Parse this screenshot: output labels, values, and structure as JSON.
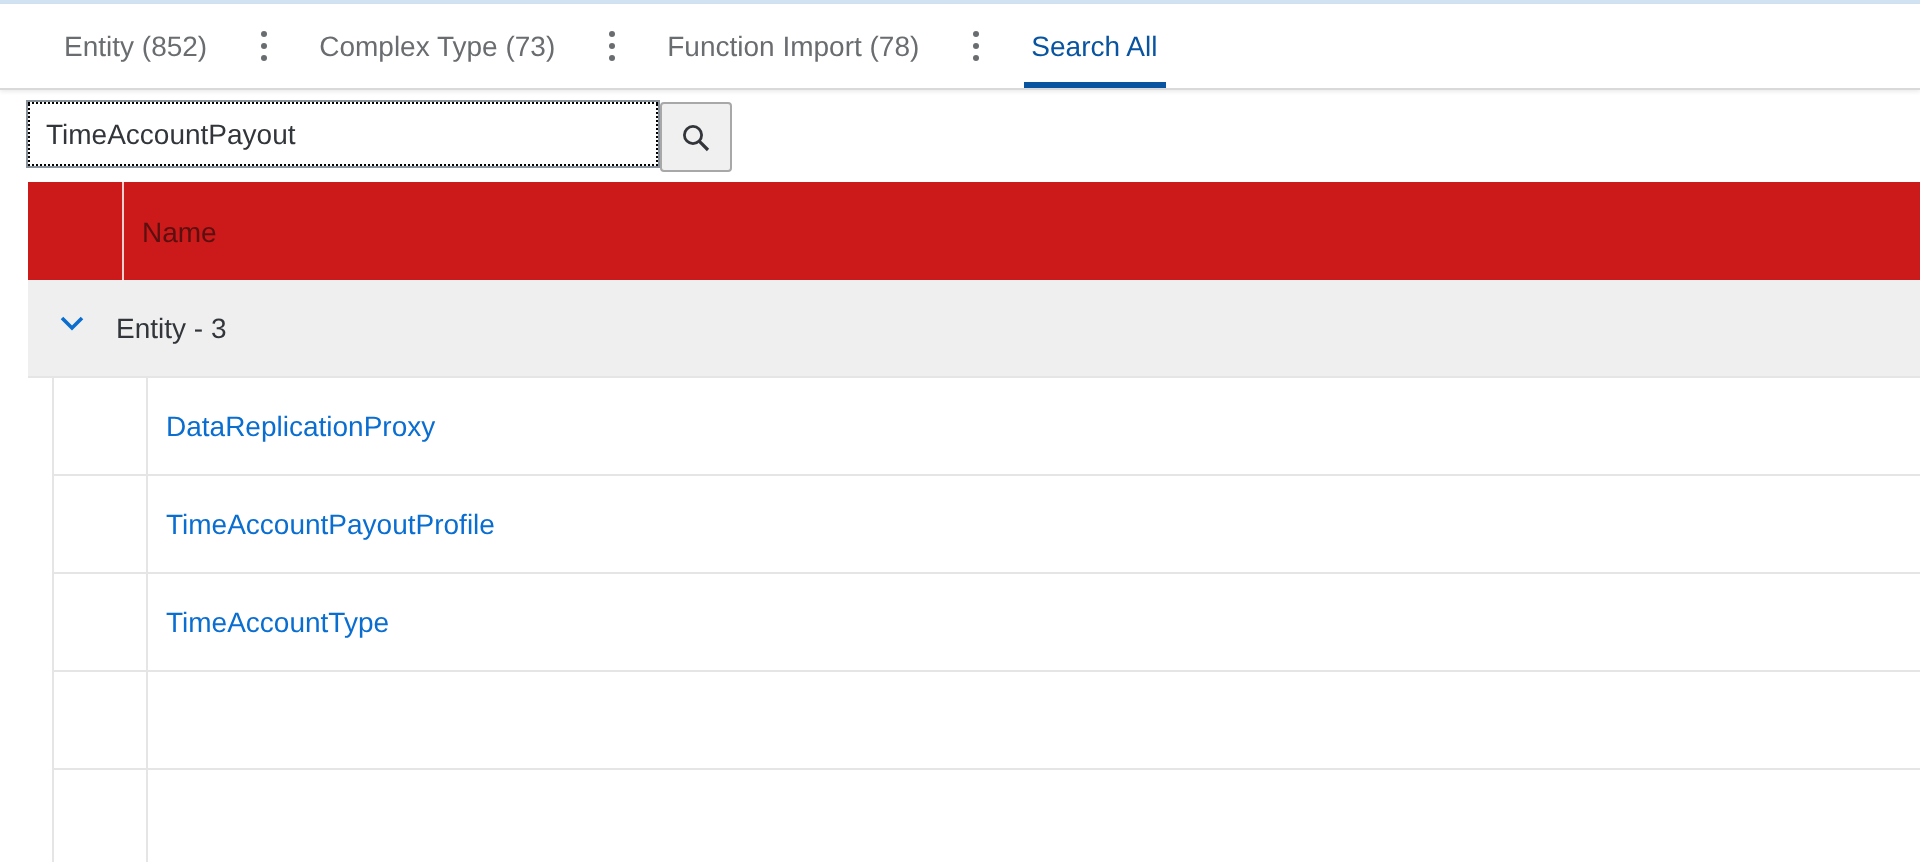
{
  "tabs": [
    {
      "label": "Entity (852)",
      "selected": false
    },
    {
      "label": "Complex Type (73)",
      "selected": false
    },
    {
      "label": "Function Import (78)",
      "selected": false
    },
    {
      "label": "Search All",
      "selected": true
    }
  ],
  "search": {
    "value": "TimeAccountPayout"
  },
  "table": {
    "columns": [
      "Name"
    ],
    "groups": [
      {
        "label": "Entity - 3",
        "expanded": true,
        "rows": [
          "DataReplicationProxy",
          "TimeAccountPayoutProfile",
          "TimeAccountType"
        ]
      }
    ]
  }
}
